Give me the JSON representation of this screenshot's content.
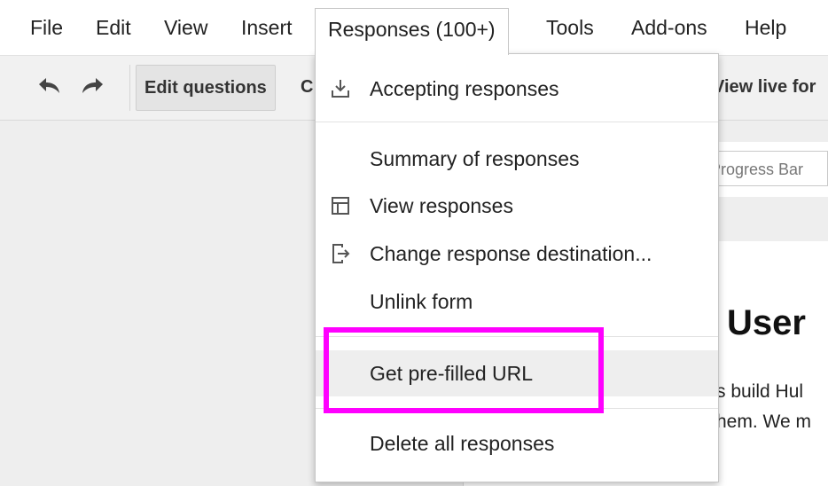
{
  "menubar": {
    "items": [
      {
        "label": "File"
      },
      {
        "label": "Edit"
      },
      {
        "label": "View"
      },
      {
        "label": "Insert"
      },
      {
        "label": "Responses (100+)",
        "open": true
      },
      {
        "label": "Tools"
      },
      {
        "label": "Add-ons"
      },
      {
        "label": "Help"
      }
    ]
  },
  "toolbar": {
    "undo_icon": "undo-icon",
    "redo_icon": "redo-icon",
    "edit_questions_label": "Edit questions",
    "truncated_button_label": "C",
    "view_live_form_label": "View live for"
  },
  "form_page": {
    "progress_field_value": "Progress Bar",
    "heading_fragment": "User",
    "body_line_1": "s build Hul",
    "body_line_2": "hem.  We m"
  },
  "responses_menu": {
    "items": [
      {
        "label": "Accepting responses",
        "icon": "download-tray-icon"
      },
      {
        "label": "Summary of responses"
      },
      {
        "label": "View responses",
        "icon": "table-icon"
      },
      {
        "label": "Change response destination...",
        "icon": "export-arrow-icon"
      },
      {
        "label": "Unlink form"
      },
      {
        "label": "Get pre-filled URL",
        "hovered": true
      },
      {
        "label": "Delete all responses"
      }
    ]
  },
  "colors": {
    "highlight": "#ff00ff",
    "menu_hover": "#eeeeee",
    "toolbar_bg": "#f1f1f1"
  }
}
